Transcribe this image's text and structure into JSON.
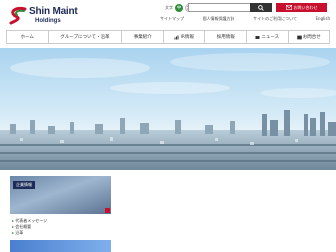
{
  "header": {
    "brand_name": "Shin Maint",
    "brand_sub": "Holdings",
    "font_size_label": "文字",
    "font_sizes": [
      "中",
      "大"
    ],
    "search": {
      "placeholder": "",
      "button_label": "検索"
    },
    "contact_label": "お問い合わせ",
    "utility_links": [
      "サイトマップ",
      "個人情報保護方針",
      "サイトのご利用について",
      "English"
    ]
  },
  "nav": [
    {
      "label": "ホーム",
      "icon": ""
    },
    {
      "label": "グループについて・沿革",
      "icon": ""
    },
    {
      "label": "事業紹介",
      "icon": ""
    },
    {
      "label": "IR情報",
      "icon": "chart-icon"
    },
    {
      "label": "採用情報",
      "icon": ""
    },
    {
      "label": "ニュース",
      "icon": "news-icon"
    },
    {
      "label": "お問合せ",
      "icon": "mail-icon"
    }
  ],
  "hero": {
    "theme": "city-skyline"
  },
  "content": {
    "card_caption": "企業情報",
    "links": [
      "代表者メッセージ",
      "会社概要",
      "沿革"
    ]
  },
  "colors": {
    "brand_navy": "#1d2b59",
    "brand_green": "#2e8b3a",
    "accent_red": "#c8102e"
  }
}
